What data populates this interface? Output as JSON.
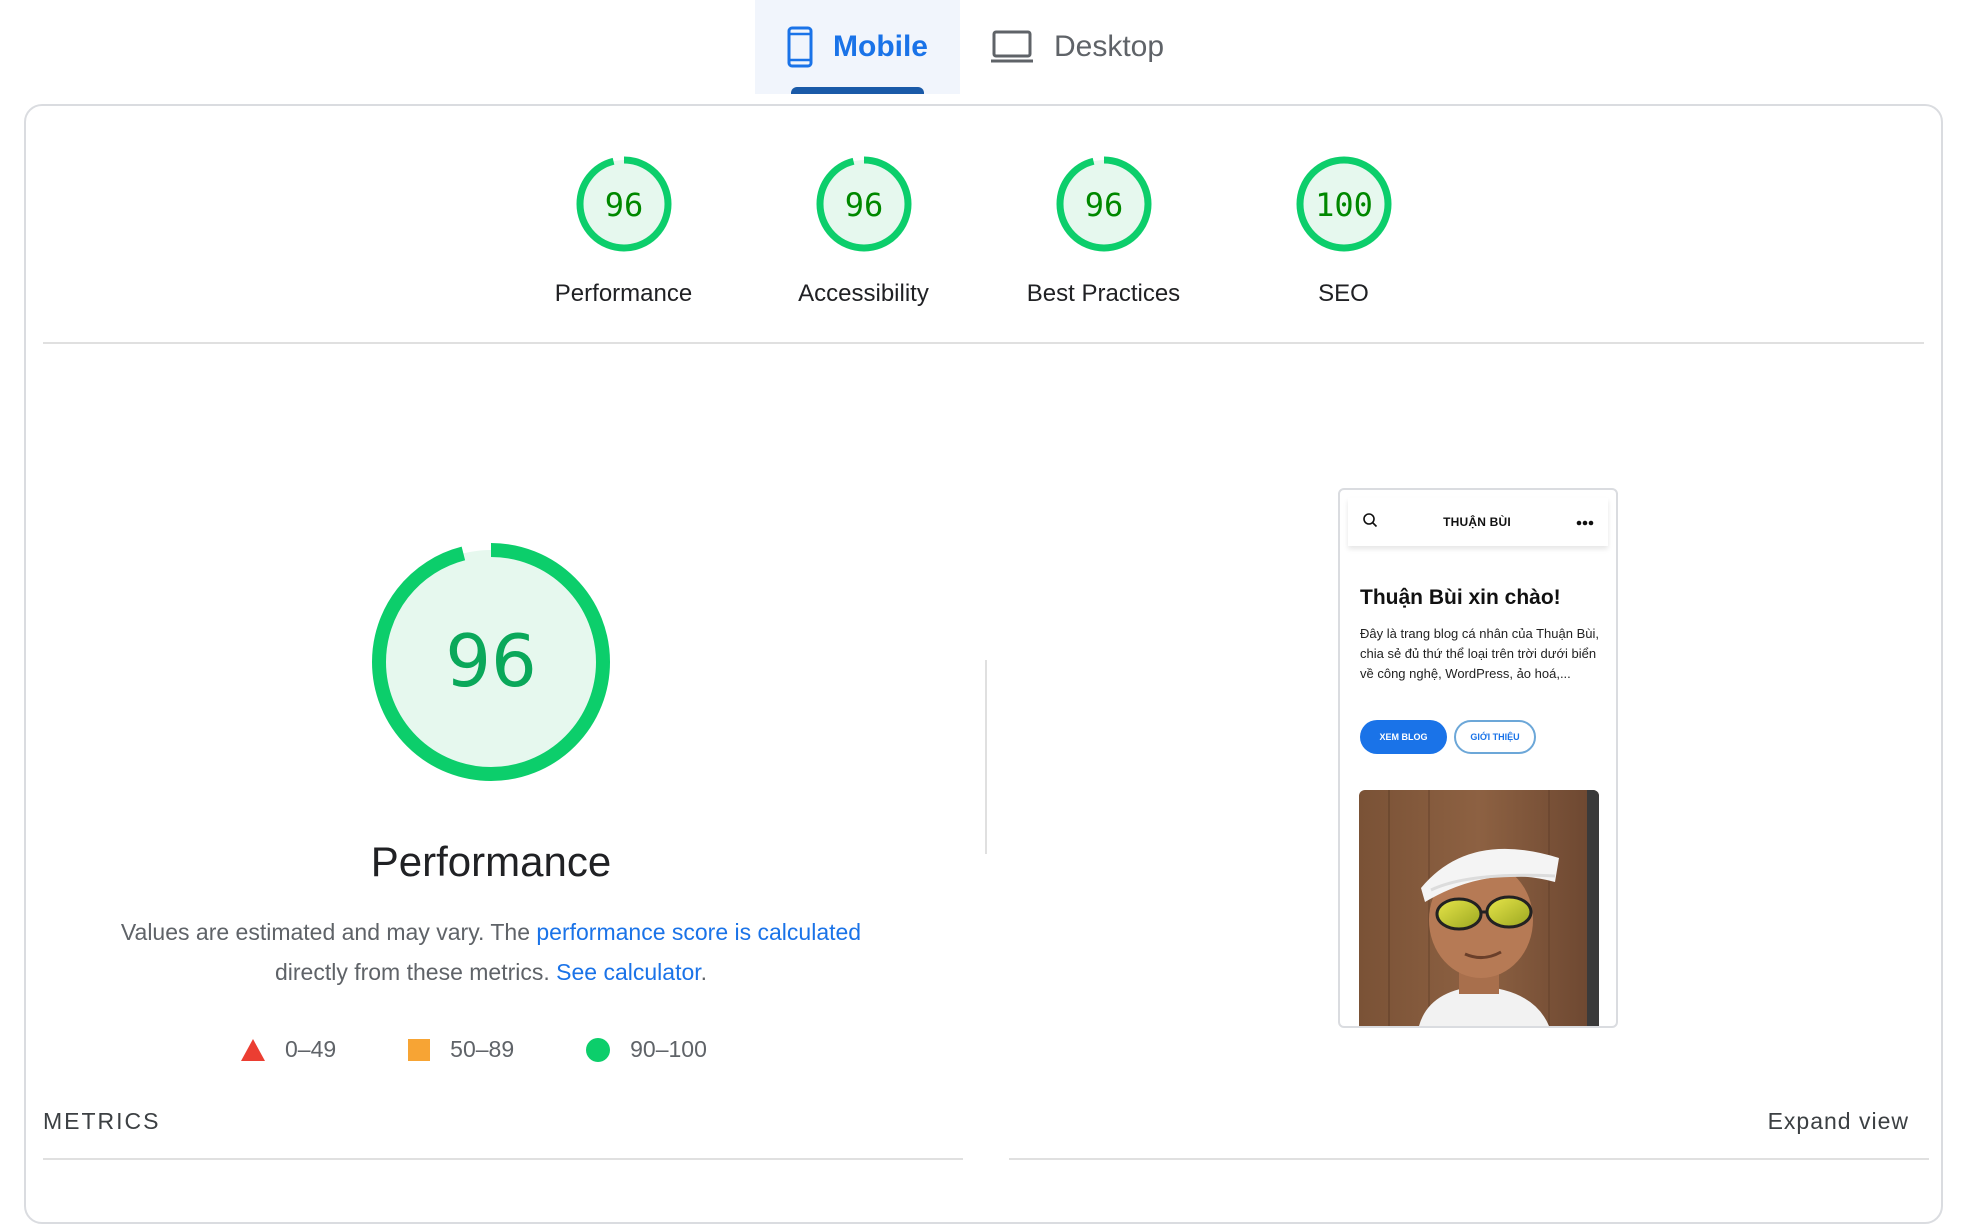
{
  "tabs": {
    "mobile": {
      "label": "Mobile",
      "icon": "phone-icon",
      "active": true
    },
    "desktop": {
      "label": "Desktop",
      "icon": "laptop-icon",
      "active": false
    }
  },
  "categories": [
    {
      "label": "Performance",
      "score": "96"
    },
    {
      "label": "Accessibility",
      "score": "96"
    },
    {
      "label": "Best Practices",
      "score": "96"
    },
    {
      "label": "SEO",
      "score": "100"
    }
  ],
  "performance": {
    "score": "96",
    "title": "Performance",
    "desc_prefix": "Values are estimated and may vary. The ",
    "desc_link1": "performance score is calculated",
    "desc_mid": " directly from these metrics. ",
    "desc_link2": "See calculator",
    "desc_suffix": "."
  },
  "legend": {
    "fail": "0–49",
    "average": "50–89",
    "pass": "90–100"
  },
  "preview": {
    "site_name": "THUẬN BÙI",
    "heading": "Thuận Bùi xin chào!",
    "text": "Đây là trang blog cá nhân của Thuận Bùi, chia sẻ đủ thứ thể loại trên trời dưới biển về công nghệ, WordPress, ảo hoá,...",
    "primary_button": "XEM BLOG",
    "secondary_button": "GIỚI THIỆU"
  },
  "metrics": {
    "label": "METRICS",
    "expand": "Expand view"
  },
  "colors": {
    "pass": "#0cce6b",
    "pass_bg": "#e6f8ee",
    "pass_text": "#008800",
    "accent": "#1a73e8",
    "fail": "#eb3e32",
    "average": "#f7a434"
  }
}
